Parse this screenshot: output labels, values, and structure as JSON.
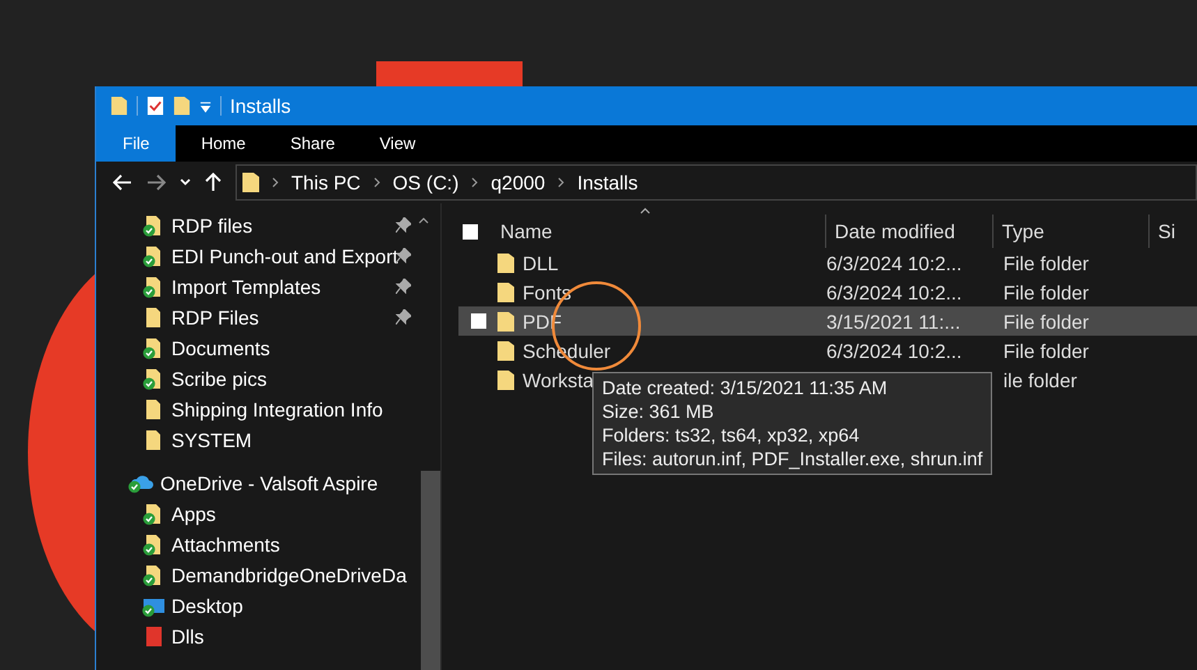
{
  "window": {
    "title": "Installs"
  },
  "ribbon_tabs": [
    {
      "label": "File",
      "selected": true
    },
    {
      "label": "Home",
      "selected": false
    },
    {
      "label": "Share",
      "selected": false
    },
    {
      "label": "View",
      "selected": false
    }
  ],
  "navigation": {
    "forward_disabled": true
  },
  "breadcrumb": [
    "This PC",
    "OS (C:)",
    "q2000",
    "Installs"
  ],
  "sidebar": {
    "items": [
      {
        "kind": "folder",
        "label": "RDP files",
        "synced": true,
        "pinned": true
      },
      {
        "kind": "folder",
        "label": "EDI Punch-out and Export",
        "synced": true,
        "pinned": true
      },
      {
        "kind": "folder",
        "label": "Import Templates",
        "synced": true,
        "pinned": true
      },
      {
        "kind": "folder",
        "label": "RDP Files",
        "synced": false,
        "pinned": true
      },
      {
        "kind": "folder",
        "label": "Documents",
        "synced": true,
        "pinned": false
      },
      {
        "kind": "folder",
        "label": "Scribe pics",
        "synced": true,
        "pinned": false
      },
      {
        "kind": "folder",
        "label": "Shipping Integration Info",
        "synced": false,
        "pinned": false
      },
      {
        "kind": "folder",
        "label": "SYSTEM",
        "synced": false,
        "pinned": false
      },
      {
        "kind": "cloud",
        "label": "OneDrive - Valsoft Aspire",
        "synced": true,
        "pinned": false
      },
      {
        "kind": "folder",
        "label": "Apps",
        "synced": true,
        "pinned": false
      },
      {
        "kind": "folder",
        "label": "Attachments",
        "synced": true,
        "pinned": false
      },
      {
        "kind": "folder",
        "label": "DemandbridgeOneDriveDa",
        "synced": true,
        "pinned": false
      },
      {
        "kind": "desktop",
        "label": "Desktop",
        "synced": true,
        "pinned": false
      },
      {
        "kind": "red-folder",
        "label": "Dlls",
        "synced": false,
        "pinned": false
      }
    ]
  },
  "table": {
    "select_all_checked": false,
    "columns": [
      "Name",
      "Date modified",
      "Type",
      "Si"
    ],
    "rows": [
      {
        "name": "DLL",
        "date": "6/3/2024 10:2...",
        "type": "File folder",
        "selected": false
      },
      {
        "name": "Fonts",
        "date": "6/3/2024 10:2...",
        "type": "File folder",
        "selected": false
      },
      {
        "name": "PDF",
        "date": "3/15/2021 11:...",
        "type": "File folder",
        "selected": true
      },
      {
        "name": "Scheduler",
        "date": "6/3/2024 10:2...",
        "type": "File folder",
        "selected": false
      },
      {
        "name": "Worksta",
        "date": "",
        "type": "ile folder",
        "selected": false
      }
    ]
  },
  "tooltip": [
    "Date created: 3/15/2021 11:35 AM",
    "Size: 361 MB",
    "Folders: ts32, ts64, xp32, xp64",
    "Files: autorun.inf, PDF_Installer.exe, shrun.inf"
  ]
}
